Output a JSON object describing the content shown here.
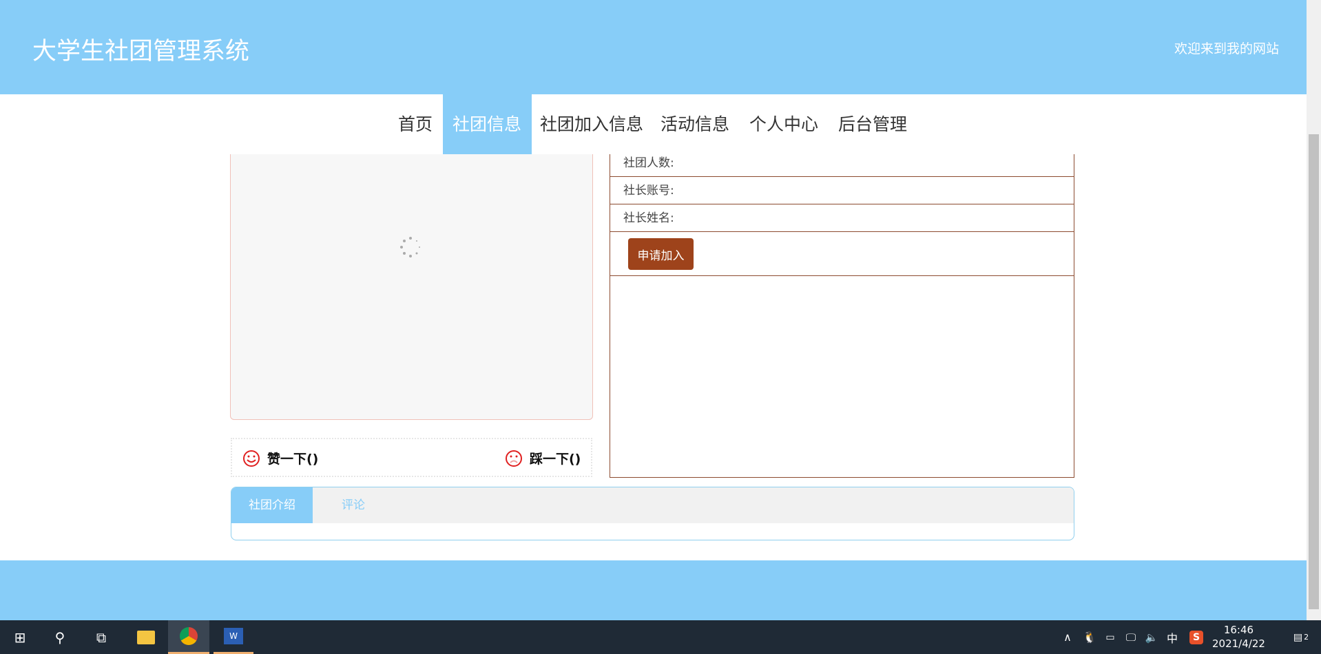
{
  "header": {
    "title": "大学生社团管理系统",
    "welcome": "欢迎来到我的网站"
  },
  "nav": [
    {
      "label": "首页"
    },
    {
      "label": "社团信息",
      "active": true
    },
    {
      "label": "社团加入信息"
    },
    {
      "label": "活动信息"
    },
    {
      "label": "个人中心"
    },
    {
      "label": "后台管理"
    }
  ],
  "votes": {
    "like": "赞一下()",
    "dislike": "踩一下()"
  },
  "info": {
    "members": "社团人数:",
    "leader_account": "社长账号:",
    "leader_name": "社长姓名:",
    "apply": "申请加入"
  },
  "tabs": [
    {
      "label": "社团介绍",
      "active": true
    },
    {
      "label": "评论"
    }
  ],
  "taskbar": {
    "time": "16:46",
    "date": "2021/4/22",
    "ime": "中",
    "notifications": "2"
  },
  "colors": {
    "primary": "#87cdf8",
    "button": "#9e431b",
    "border": "#8b4a2e"
  }
}
